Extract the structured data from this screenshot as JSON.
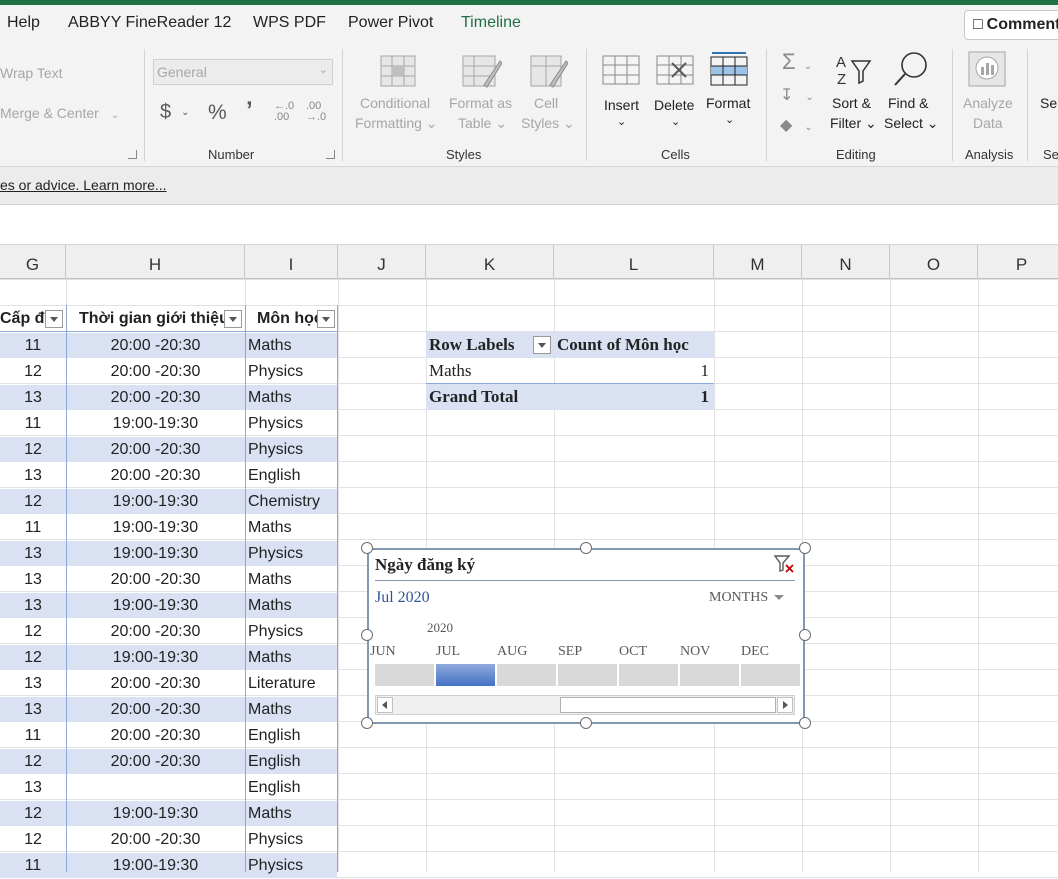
{
  "menu": {
    "items": [
      "Help",
      "ABBYY FineReader 12",
      "WPS PDF",
      "Power Pivot",
      "Timeline"
    ],
    "active": "Timeline",
    "comments_label": "Comments"
  },
  "ribbon": {
    "alignment": {
      "wrap_text": "Wrap Text",
      "merge_center": "Merge & Center"
    },
    "number": {
      "format_value": "General",
      "currency_symbol": "$",
      "percent_symbol": "%",
      "comma_symbol": "ʼ",
      "increase_decimal": "←.0 .00",
      "decrease_decimal": ".00 →.0",
      "group_label": "Number"
    },
    "styles": {
      "conditional_1": "Conditional",
      "conditional_2": "Formatting",
      "format_table_1": "Format as",
      "format_table_2": "Table",
      "cell_styles_1": "Cell",
      "cell_styles_2": "Styles",
      "group_label": "Styles"
    },
    "cells": {
      "insert": "Insert",
      "delete": "Delete",
      "format": "Format",
      "group_label": "Cells"
    },
    "editing": {
      "sort_1": "Sort &",
      "sort_2": "Filter",
      "find_1": "Find &",
      "find_2": "Select",
      "group_label": "Editing"
    },
    "analysis": {
      "analyze_1": "Analyze",
      "analyze_2": "Data",
      "group_label": "Analysis"
    },
    "overflow": {
      "label_top": "Ser",
      "label_bottom": "Se"
    }
  },
  "message_bar": {
    "text": "es or advice. Learn more..."
  },
  "columns": [
    "G",
    "H",
    "I",
    "J",
    "K",
    "L",
    "M",
    "N",
    "O",
    "P"
  ],
  "table": {
    "headers": [
      "Cấp độ",
      "Thời gian giới thiệu",
      "Môn học"
    ],
    "rows": [
      [
        "11",
        "20:00 -20:30",
        "Maths"
      ],
      [
        "12",
        "20:00 -20:30",
        "Physics"
      ],
      [
        "13",
        "20:00 -20:30",
        "Maths"
      ],
      [
        "11",
        "19:00-19:30",
        "Physics"
      ],
      [
        "12",
        "20:00 -20:30",
        "Physics"
      ],
      [
        "13",
        "20:00 -20:30",
        "English"
      ],
      [
        "12",
        "19:00-19:30",
        "Chemistry"
      ],
      [
        "11",
        "19:00-19:30",
        "Maths"
      ],
      [
        "13",
        "19:00-19:30",
        "Physics"
      ],
      [
        "13",
        "20:00 -20:30",
        "Maths"
      ],
      [
        "13",
        "19:00-19:30",
        "Maths"
      ],
      [
        "12",
        "20:00 -20:30",
        "Physics"
      ],
      [
        "12",
        "19:00-19:30",
        "Maths"
      ],
      [
        "13",
        "20:00 -20:30",
        "Literature"
      ],
      [
        "13",
        "20:00 -20:30",
        "Maths"
      ],
      [
        "11",
        "20:00 -20:30",
        "English"
      ],
      [
        "12",
        "20:00 -20:30",
        "English"
      ],
      [
        "13",
        "",
        "English"
      ],
      [
        "12",
        "19:00-19:30",
        "Maths"
      ],
      [
        "12",
        "20:00 -20:30",
        "Physics"
      ],
      [
        "11",
        "19:00-19:30",
        "Physics"
      ]
    ]
  },
  "pivot": {
    "row_labels": "Row Labels",
    "count_label": "Count of Môn học",
    "rows": [
      {
        "label": "Maths",
        "value": "1"
      }
    ],
    "total_label": "Grand Total",
    "total_value": "1"
  },
  "timeline": {
    "title": "Ngày đăng ký",
    "selection": "Jul 2020",
    "level": "MONTHS",
    "year": "2020",
    "months": [
      "JUN",
      "JUL",
      "AUG",
      "SEP",
      "OCT",
      "NOV",
      "DEC"
    ],
    "selected_month": "JUL"
  },
  "colors": {
    "accent": "#1e7145",
    "band": "#d9e1f2",
    "selection": "#4472c4"
  }
}
